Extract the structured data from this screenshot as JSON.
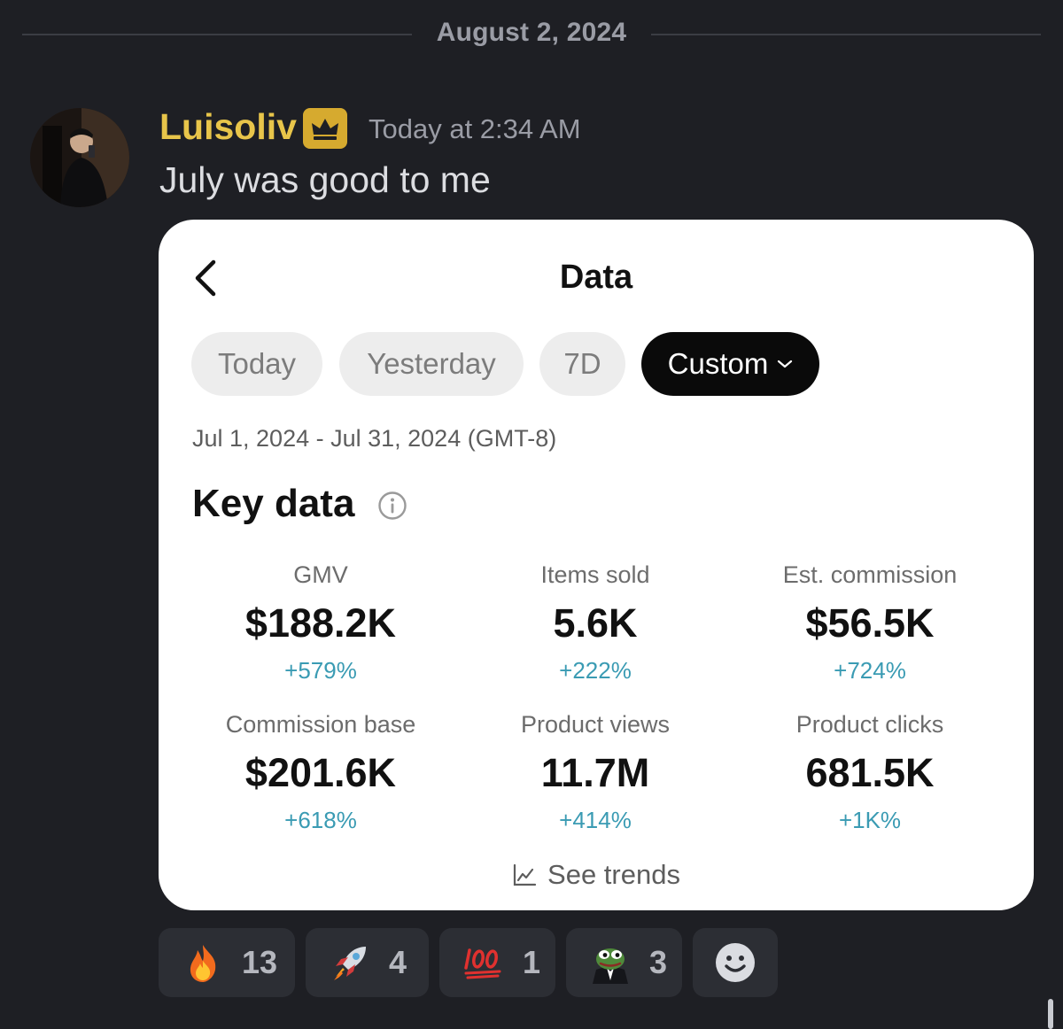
{
  "divider": {
    "date": "August 2, 2024"
  },
  "message": {
    "username": "Luisoliv",
    "timestamp": "Today at 2:34 AM",
    "text": "July was good to me",
    "badge_icon": "crown-icon"
  },
  "card": {
    "title": "Data",
    "tabs": [
      {
        "label": "Today",
        "active": false
      },
      {
        "label": "Yesterday",
        "active": false
      },
      {
        "label": "7D",
        "active": false
      },
      {
        "label": "Custom",
        "active": true
      }
    ],
    "date_range": "Jul 1, 2024 - Jul 31, 2024 (GMT-8)",
    "section_title": "Key data",
    "metrics": [
      {
        "label": "GMV",
        "value": "$188.2K",
        "change": "+579%"
      },
      {
        "label": "Items sold",
        "value": "5.6K",
        "change": "+222%"
      },
      {
        "label": "Est. commission",
        "value": "$56.5K",
        "change": "+724%"
      },
      {
        "label": "Commission base",
        "value": "$201.6K",
        "change": "+618%"
      },
      {
        "label": "Product views",
        "value": "11.7M",
        "change": "+414%"
      },
      {
        "label": "Product clicks",
        "value": "681.5K",
        "change": "+1K%"
      }
    ],
    "trends_label": "See trends"
  },
  "reactions": [
    {
      "emoji": "fire-emoji",
      "count": "13"
    },
    {
      "emoji": "rocket-emoji",
      "count": "4"
    },
    {
      "emoji": "hundred-points-emoji",
      "count": "1"
    },
    {
      "emoji": "pepe-tuxedo-emoji",
      "count": "3"
    }
  ],
  "colors": {
    "background": "#1e1f24",
    "username": "#e8c54a",
    "badge": "#d6aa2f",
    "change_positive": "#3a9bb3",
    "active_tab": "#0a0a0a"
  }
}
